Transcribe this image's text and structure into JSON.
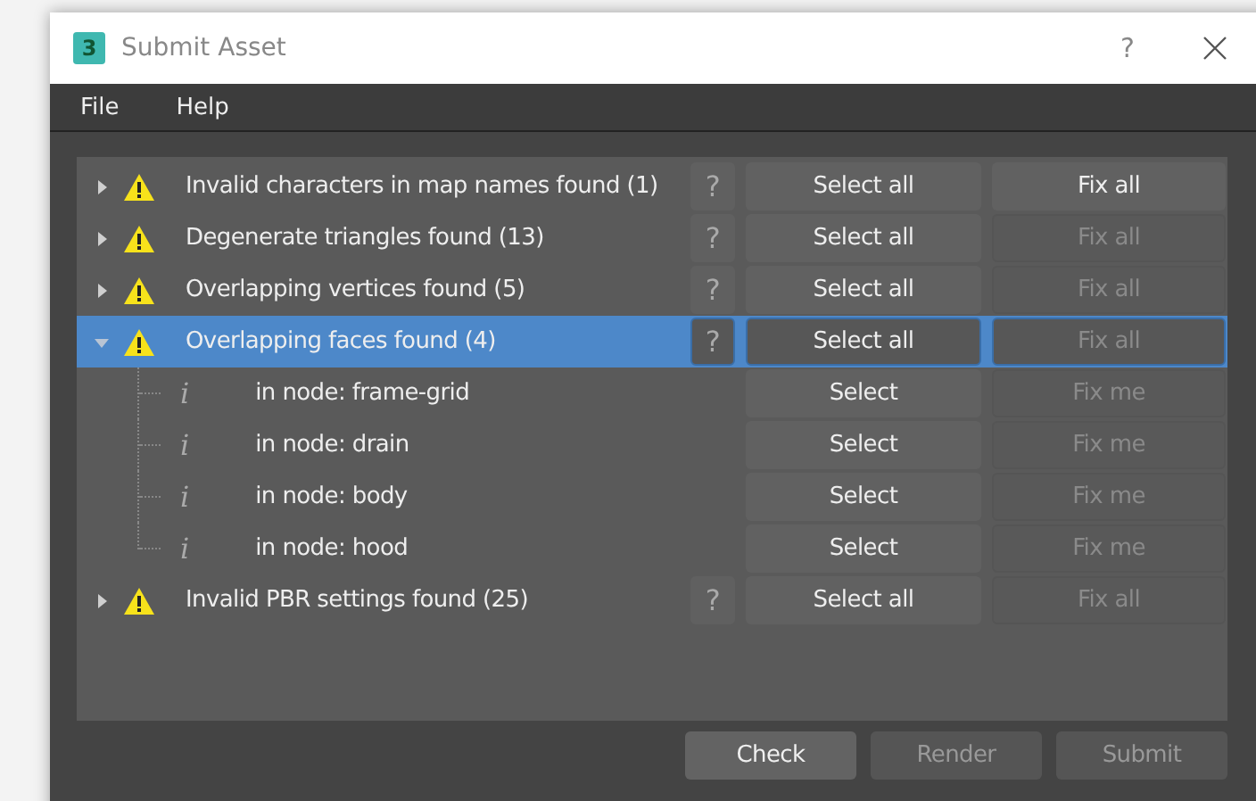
{
  "window": {
    "title": "Submit Asset",
    "icon_text": "3",
    "help": "?"
  },
  "menu": [
    "File",
    "Help"
  ],
  "issues": [
    {
      "label": "Invalid characters in map names found (1)",
      "help": "?",
      "select": "Select all",
      "fix": "Fix all",
      "fix_disabled": false,
      "expanded": false,
      "selected": false
    },
    {
      "label": "Degenerate triangles found (13)",
      "help": "?",
      "select": "Select all",
      "fix": "Fix all",
      "fix_disabled": true,
      "expanded": false,
      "selected": false
    },
    {
      "label": "Overlapping vertices found (5)",
      "help": "?",
      "select": "Select all",
      "fix": "Fix all",
      "fix_disabled": true,
      "expanded": false,
      "selected": false
    },
    {
      "label": "Overlapping faces found (4)",
      "help": "?",
      "select": "Select all",
      "fix": "Fix all",
      "fix_disabled": true,
      "expanded": true,
      "selected": true,
      "children": [
        {
          "icon": "i",
          "label": "in node: frame-grid",
          "select": "Select",
          "fix": "Fix me",
          "fix_disabled": true
        },
        {
          "icon": "i",
          "label": "in node: drain",
          "select": "Select",
          "fix": "Fix me",
          "fix_disabled": true
        },
        {
          "icon": "i",
          "label": "in node: body",
          "select": "Select",
          "fix": "Fix me",
          "fix_disabled": true
        },
        {
          "icon": "i",
          "label": "in node: hood",
          "select": "Select",
          "fix": "Fix me",
          "fix_disabled": true
        }
      ]
    },
    {
      "label": "Invalid PBR settings found (25)",
      "help": "?",
      "select": "Select all",
      "fix": "Fix all",
      "fix_disabled": true,
      "expanded": false,
      "selected": false
    }
  ],
  "buttons": [
    {
      "label": "Check",
      "disabled": false
    },
    {
      "label": "Render",
      "disabled": true
    },
    {
      "label": "Submit",
      "disabled": true
    }
  ]
}
